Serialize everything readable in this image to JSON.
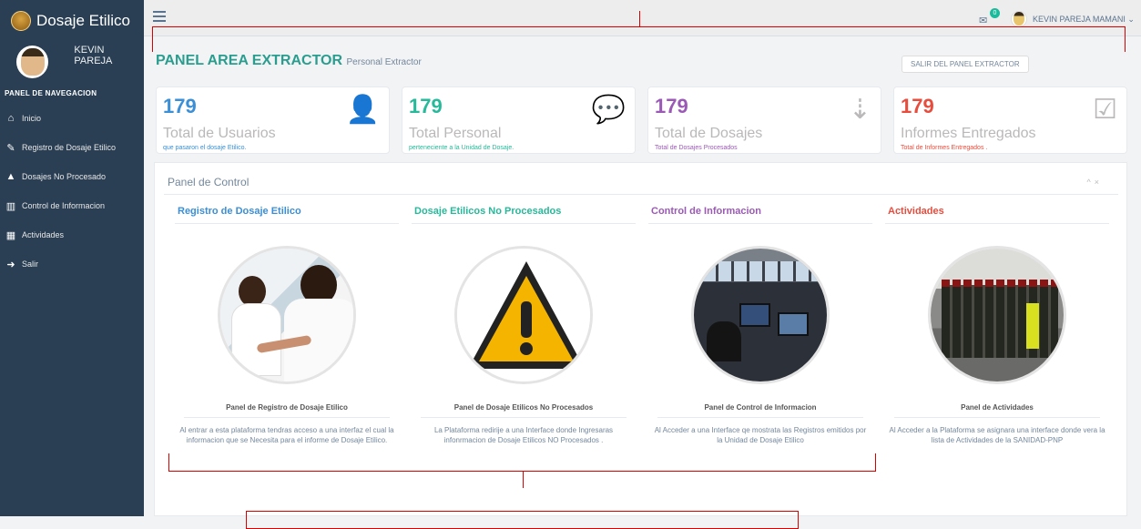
{
  "sidebar": {
    "brand": "Dosaje Etilico",
    "user": "KEVIN PAREJA",
    "nav_title": "PANEL DE NAVEGACION",
    "items": [
      {
        "icon": "home-icon",
        "glyph": "⌂",
        "label": "Inicio"
      },
      {
        "icon": "edit-icon",
        "glyph": "✎",
        "label": "Registro de Dosaje Etilico"
      },
      {
        "icon": "warning-icon",
        "glyph": "▲",
        "label": "Dosajes No Procesado"
      },
      {
        "icon": "bar-chart-icon",
        "glyph": "▥",
        "label": "Control de Informacion"
      },
      {
        "icon": "table-icon",
        "glyph": "▦",
        "label": "Actividades"
      },
      {
        "icon": "sign-out-icon",
        "glyph": "➜",
        "label": "Salir"
      }
    ]
  },
  "topbar": {
    "badge": "0",
    "user": "KEVIN PAREJA MAMANI ⌄"
  },
  "page": {
    "title": "PANEL AREA EXTRACTOR",
    "subtitle": "Personal Extractor",
    "exit_label": "SALIR DEL PANEL EXTRACTOR"
  },
  "tiles": [
    {
      "number": "179",
      "label": "Total de Usuarios",
      "desc": "que pasaron el dosaje Etilico.",
      "color": "#3a8fd6",
      "desc_color": "#3a8fd6",
      "icon": "user-icon",
      "glyph": "👤"
    },
    {
      "number": "179",
      "label": "Total Personal",
      "desc": "perteneciente a la Unidad de Dosaje.",
      "color": "#26b99a",
      "desc_color": "#26b99a",
      "icon": "comments-icon",
      "glyph": "💬"
    },
    {
      "number": "179",
      "label": "Total de Dosajes",
      "desc": "Total de Dosajes Procesados",
      "color": "#9b59b6",
      "desc_color": "#9b59b6",
      "icon": "sort-amount-icon",
      "glyph": "⇣"
    },
    {
      "number": "179",
      "label": "Informes Entregados",
      "desc": "Total de Informes Entregados .",
      "color": "#e74c3c",
      "desc_color": "#e74c3c",
      "icon": "check-square-icon",
      "glyph": "☑"
    }
  ],
  "panel": {
    "title": "Panel de Control",
    "controls": "^ ×",
    "columns": [
      {
        "title": "Registro de Dosaje Etilico",
        "color": "#3a8fd6",
        "image": "blood-draw-photo",
        "caption": "Panel de Registro de Dosaje Etilico",
        "text": "Al entrar a esta plataforma tendras acceso a una interfaz el cual la informacion que se Necesita para el informe de Dosaje Etilico."
      },
      {
        "title": "Dosaje Etilicos No Procesados",
        "color": "#26b99a",
        "image": "warning-sign-image",
        "caption": "Panel de Dosaje Etilicos No Procesados",
        "text": "La Plataforma redirije a una Interface donde Ingresaras infonrmacion de Dosaje Etilicos NO Procesados ."
      },
      {
        "title": "Control de Informacion",
        "color": "#9b59b6",
        "image": "control-room-photo",
        "caption": "Panel de Control de Informacion",
        "text": "Al Acceder a una Interface qe mostrata las Registros emitidos por la Unidad de Dosaje Etilico"
      },
      {
        "title": "Actividades",
        "color": "#e74c3c",
        "image": "police-formation-photo",
        "caption": "Panel de Actividades",
        "text": "Al Acceder a la Plataforma se asignara una interface donde vera la lista de Actividades de la SANIDAD-PNP"
      }
    ]
  }
}
